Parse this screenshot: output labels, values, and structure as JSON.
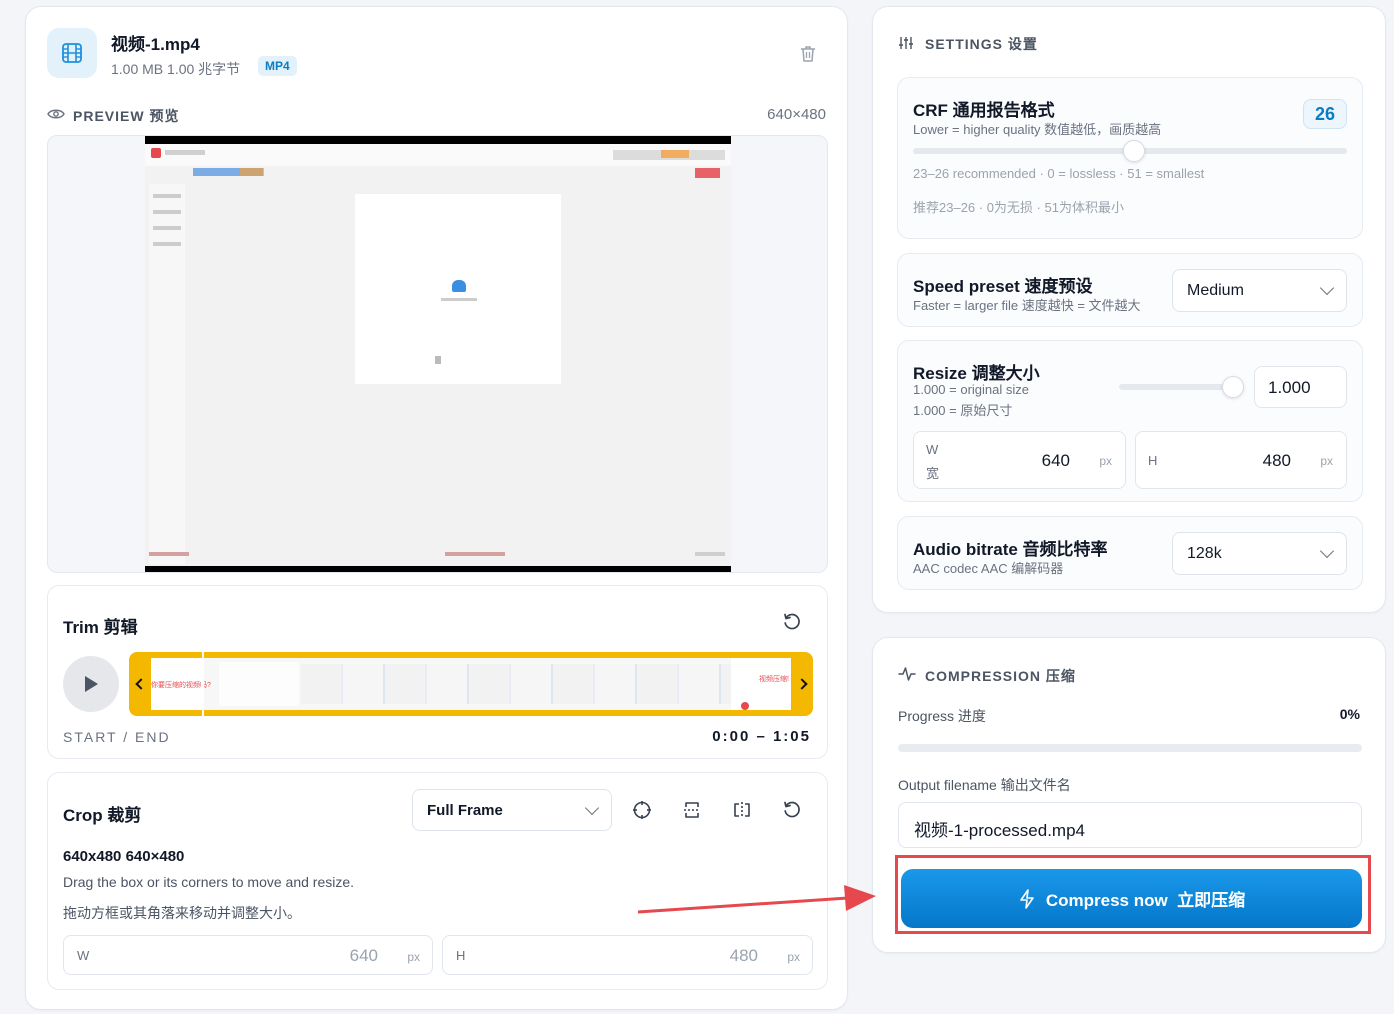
{
  "file": {
    "name": "视频-1.mp4",
    "size": "1.00 MB 1.00 兆字节",
    "badge": "MP4"
  },
  "preview": {
    "label": "PREVIEW 预览",
    "dimensions": "640×480"
  },
  "trim": {
    "title": "Trim 剪辑",
    "start_end_label": "START / END",
    "range": "0:00 – 1:05",
    "thumb_text_left": "你要压缩的视频吗?",
    "thumb_text_right": "视频压缩!"
  },
  "crop": {
    "title": "Crop 裁剪",
    "mode": "Full Frame",
    "size_label": "640x480 640×480",
    "hint_en": "Drag the box or its corners to move and resize.",
    "hint_zh": "拖动方框或其角落来移动并调整大小。",
    "w_label": "W",
    "w_value": "640",
    "h_label": "H",
    "h_value": "480",
    "unit": "px"
  },
  "settings": {
    "title": "SETTINGS 设置",
    "crf": {
      "title": "CRF 通用报告格式",
      "subtitle": "Lower = higher quality 数值越低，画质越高",
      "value": "26",
      "level": 26,
      "range": [
        0,
        51
      ],
      "note_en": "23–26 recommended · 0 = lossless · 51 = smallest",
      "note_zh": "推荐23–26 · 0为无损 · 51为体积最小"
    },
    "preset": {
      "title": "Speed preset 速度预设",
      "subtitle": "Faster = larger file 速度越快 = 文件越大",
      "value": "Medium"
    },
    "resize": {
      "title": "Resize 调整大小",
      "subtitle_en": "1.000 = original size",
      "subtitle_zh": "1.000 = 原始尺寸",
      "value": "1.000",
      "w_label": "W",
      "w_label_zh": "宽",
      "w_value": "640",
      "h_label": "H",
      "h_value": "480",
      "unit": "px"
    },
    "audio": {
      "title": "Audio bitrate 音频比特率",
      "subtitle": "AAC codec AAC 编解码器",
      "value": "128k"
    }
  },
  "compression": {
    "title": "COMPRESSION 压缩",
    "progress_label": "Progress 进度",
    "progress_value": "0%",
    "progress": 0,
    "output_label": "Output filename 输出文件名",
    "output_value": "视频-1-processed.mp4",
    "button_label": "Compress now  立即压缩"
  },
  "colors": {
    "accent": "#0a84d6",
    "badge_bg": "#e3f1fb",
    "trim_frame": "#f5b800",
    "highlight": "#e5484d"
  }
}
